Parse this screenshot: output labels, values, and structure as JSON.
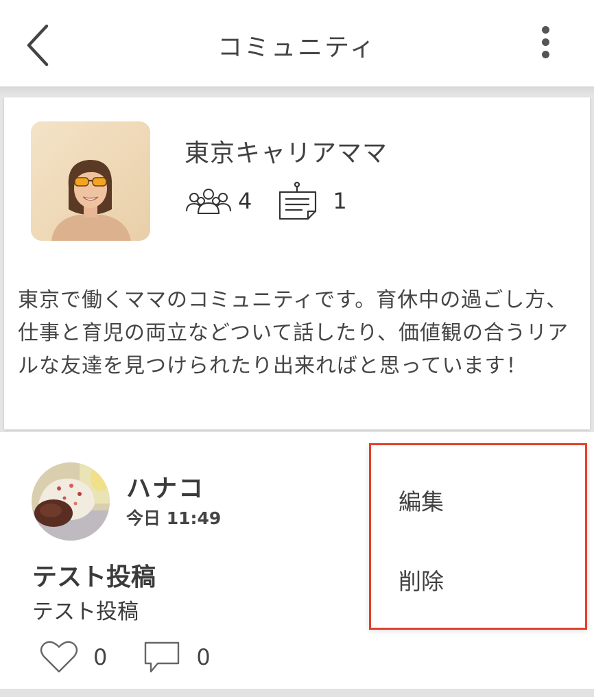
{
  "header": {
    "title": "コミュニティ",
    "back_icon": "chevron-left-icon",
    "more_icon": "kebab-menu-icon"
  },
  "community": {
    "name": "東京キャリアママ",
    "members_count": "4",
    "posts_count": "1",
    "description": "東京で働くママのコミュニティです。育休中の過ごし方、仕事と育児の両立などついて話したり、価値観の合うリアルな友達を見つけられたり出来ればと思っています！"
  },
  "post": {
    "user_name": "ハナコ",
    "time": "今日 11:49",
    "title": "テスト投稿",
    "body": "テスト投稿",
    "likes": "0",
    "comments": "0"
  },
  "menu": {
    "edit_label": "編集",
    "delete_label": "削除",
    "border_color": "#e4402a"
  }
}
